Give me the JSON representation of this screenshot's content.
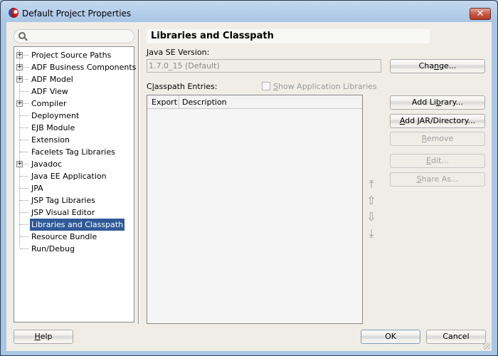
{
  "window": {
    "title": "Default Project Properties",
    "close_glyph": "✕"
  },
  "sidebar": {
    "search_placeholder": "",
    "items": [
      {
        "label": "Project Source Paths",
        "expandable": true
      },
      {
        "label": "ADF Business Components",
        "expandable": true
      },
      {
        "label": "ADF Model",
        "expandable": true
      },
      {
        "label": "ADF View",
        "expandable": false
      },
      {
        "label": "Compiler",
        "expandable": true
      },
      {
        "label": "Deployment",
        "expandable": false
      },
      {
        "label": "EJB Module",
        "expandable": false
      },
      {
        "label": "Extension",
        "expandable": false
      },
      {
        "label": "Facelets Tag Libraries",
        "expandable": false
      },
      {
        "label": "Javadoc",
        "expandable": true
      },
      {
        "label": "Java EE Application",
        "expandable": false
      },
      {
        "label": "JPA",
        "expandable": false
      },
      {
        "label": "JSP Tag Libraries",
        "expandable": false
      },
      {
        "label": "JSP Visual Editor",
        "expandable": false
      },
      {
        "label": "Libraries and Classpath",
        "expandable": false,
        "selected": true
      },
      {
        "label": "Resource Bundle",
        "expandable": false
      },
      {
        "label": "Run/Debug",
        "expandable": false
      }
    ],
    "expander_glyph": "+"
  },
  "main": {
    "title": "Libraries and Classpath",
    "java_se_label_mnemonic": "J",
    "java_se_label_rest": "ava SE Version:",
    "java_se_value": "1.7.0_15 (Default)",
    "change_button": {
      "pre": "Cha",
      "mn": "n",
      "post": "ge..."
    },
    "classpath_label": {
      "pre": "C",
      "mn": "l",
      "post": "asspath Entries:"
    },
    "show_app_libs": {
      "mn": "S",
      "post": "how Application Libraries",
      "checked": false,
      "enabled": false
    },
    "table": {
      "columns": [
        "Export",
        "Description"
      ],
      "rows": []
    },
    "buttons": {
      "add_library": {
        "pre": "Add Li",
        "mn": "b",
        "post": "rary...",
        "enabled": true
      },
      "add_jar": {
        "pre": "",
        "mn": "A",
        "post": "dd JAR/Directory...",
        "enabled": true
      },
      "remove": {
        "pre": "",
        "mn": "R",
        "post": "emove",
        "enabled": false
      },
      "edit": {
        "pre": "",
        "mn": "E",
        "post": "dit...",
        "enabled": false
      },
      "share_as": {
        "pre": "",
        "mn": "S",
        "post": "hare As...",
        "enabled": false
      }
    },
    "arrows": {
      "move_top": "⤒",
      "move_up": "⇧",
      "move_down": "⇩",
      "move_bottom": "⤓"
    }
  },
  "footer": {
    "help": {
      "mn": "H",
      "post": "elp"
    },
    "ok": "OK",
    "cancel": "Cancel"
  }
}
